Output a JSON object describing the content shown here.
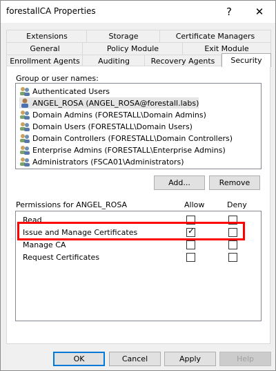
{
  "window": {
    "title": "forestallCA Properties",
    "help_glyph": "?",
    "close_glyph": "✕"
  },
  "tabs": {
    "row1": [
      "Extensions",
      "Storage",
      "Certificate Managers"
    ],
    "row2": [
      "General",
      "Policy Module",
      "Exit Module"
    ],
    "row3": [
      "Enrollment Agents",
      "Auditing",
      "Recovery Agents",
      "Security"
    ],
    "active": "Security"
  },
  "groups": {
    "label": "Group or user names:",
    "users": [
      {
        "name": "Authenticated Users",
        "icon": "group-icon"
      },
      {
        "name": "ANGEL_ROSA (ANGEL_ROSA@forestall.labs)",
        "icon": "user-icon"
      },
      {
        "name": "Domain Admins (FORESTALL\\Domain Admins)",
        "icon": "group-icon"
      },
      {
        "name": "Domain Users (FORESTALL\\Domain Users)",
        "icon": "group-icon"
      },
      {
        "name": "Domain Controllers (FORESTALL\\Domain Controllers)",
        "icon": "group-icon"
      },
      {
        "name": "Enterprise Admins (FORESTALL\\Enterprise Admins)",
        "icon": "group-icon"
      },
      {
        "name": "Administrators (FSCA01\\Administrators)",
        "icon": "group-icon"
      }
    ],
    "selected_index": 1
  },
  "buttons": {
    "add": "Add...",
    "remove": "Remove",
    "ok": "OK",
    "cancel": "Cancel",
    "apply": "Apply",
    "help": "Help"
  },
  "permissions": {
    "label": "Permissions for ANGEL_ROSA",
    "allow_header": "Allow",
    "deny_header": "Deny",
    "rows": [
      {
        "name": "Read",
        "allow": false,
        "deny": false
      },
      {
        "name": "Issue and Manage Certificates",
        "allow": true,
        "deny": false
      },
      {
        "name": "Manage CA",
        "allow": false,
        "deny": false
      },
      {
        "name": "Request Certificates",
        "allow": false,
        "deny": false
      }
    ],
    "highlighted_row": "Issue and Manage Certificates",
    "highlight_color": "#ff0000"
  }
}
